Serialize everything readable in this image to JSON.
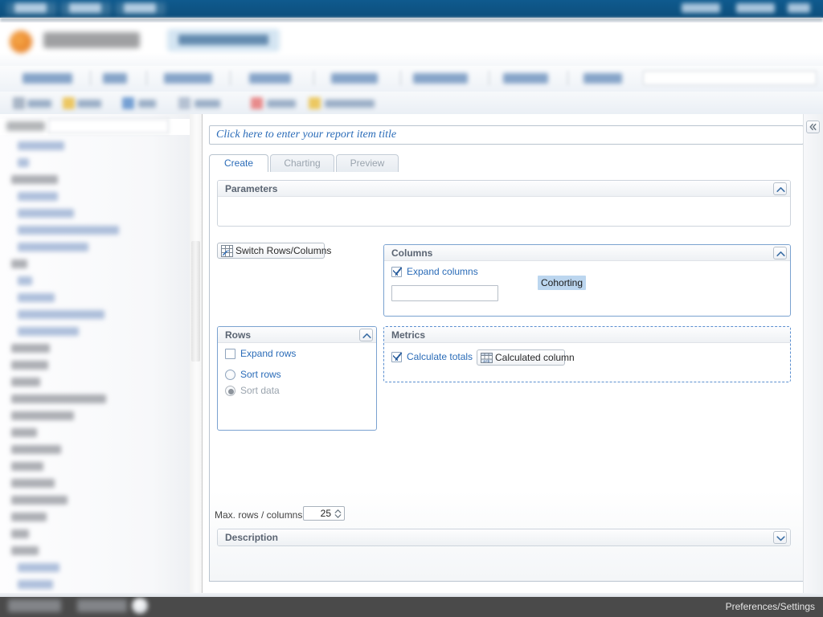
{
  "app": {
    "status_bar": {
      "right_label": "Preferences/Settings"
    }
  },
  "sidebar": {
    "search_label": "Search",
    "collapse_icon": "chevron-left-double-icon"
  },
  "report_editor": {
    "title_field": {
      "value": "",
      "placeholder": "Click here to enter your report item title"
    },
    "tabs": [
      {
        "id": "create",
        "label": "Create",
        "active": true
      },
      {
        "id": "charting",
        "label": "Charting",
        "active": false
      },
      {
        "id": "preview",
        "label": "Preview",
        "active": false
      }
    ],
    "panels": {
      "parameters": {
        "title": "Parameters",
        "collapse_icon": "chevron-up-icon",
        "expanded": true,
        "body_items": []
      },
      "columns": {
        "title": "Columns",
        "collapse_icon": "chevron-up-icon",
        "expanded": true,
        "expand_columns": {
          "label": "Expand columns",
          "checked": true
        },
        "field_value": "",
        "chips": [
          {
            "label": "Cohorting"
          }
        ]
      },
      "rows": {
        "title": "Rows",
        "collapse_icon": "chevron-up-icon",
        "expanded": true,
        "expand_rows": {
          "label": "Expand rows",
          "checked": false
        },
        "sort_options": [
          {
            "label": "Sort rows",
            "selected": false,
            "disabled": false
          },
          {
            "label": "Sort data",
            "selected": true,
            "disabled": true
          }
        ]
      },
      "metrics": {
        "title": "Metrics",
        "calculate_totals": {
          "label": "Calculate totals",
          "checked": true
        },
        "calculated_column_button": {
          "label": "Calculated column",
          "icon": "calculated-column-icon"
        }
      },
      "description": {
        "title": "Description",
        "collapse_icon": "chevron-down-icon",
        "expanded": false
      }
    },
    "switch_button": {
      "label": "Switch Rows/Columns",
      "icon": "switch-rows-columns-icon"
    },
    "max_rows": {
      "label": "Max. rows / columns",
      "value": "25"
    },
    "collapse_right_panel": {
      "icon": "chevron-left-double-icon",
      "label": "«"
    }
  }
}
